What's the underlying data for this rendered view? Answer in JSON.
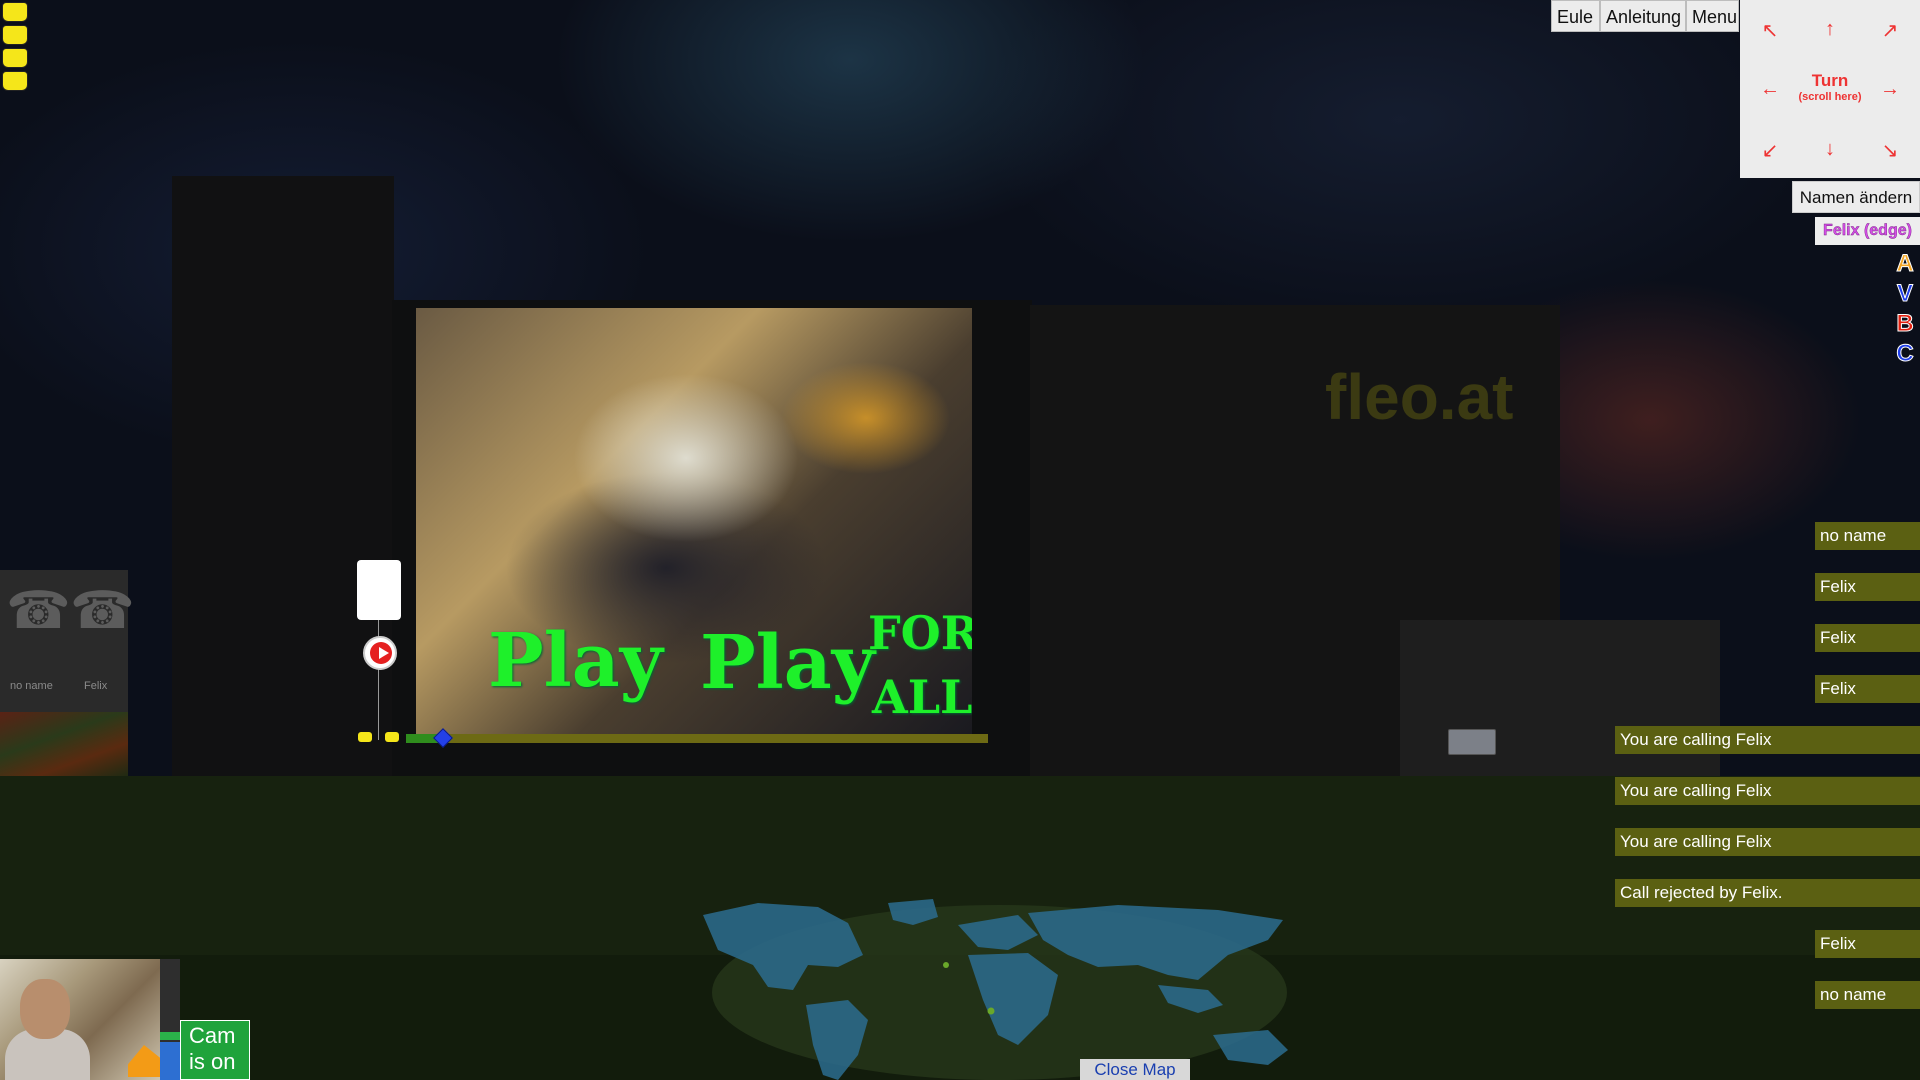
{
  "top_menu": {
    "eule": "Eule",
    "anleitung": "Anleitung",
    "menu": "Menu"
  },
  "dpad": {
    "up_left": "↖",
    "up": "↑",
    "up_right": "↗",
    "left": "←",
    "right": "→",
    "down_left": "↙",
    "down": "↓",
    "down_right": "↘",
    "turn_label": "Turn",
    "turn_hint": "(scroll here)"
  },
  "rename_button": "Namen ändern",
  "current_user": "Felix (edge)",
  "circle_buttons": [
    {
      "letter": "A",
      "color": "#f5a623"
    },
    {
      "letter": "V",
      "color": "#1f3ee8"
    },
    {
      "letter": "B",
      "color": "#e3200f"
    },
    {
      "letter": "C",
      "color": "#1f3ee8"
    }
  ],
  "site_brand": "fleo.at",
  "video": {
    "overlay_play_1": "Play",
    "overlay_play_2": "Play",
    "overlay_for": "FOR",
    "overlay_all": "ALL",
    "progress": 0.05
  },
  "phone_panel": {
    "labels": [
      "no name",
      "Felix"
    ]
  },
  "user_list": [
    "no name",
    "Felix",
    "Felix",
    "Felix"
  ],
  "call_messages": [
    "You are calling Felix",
    "You are calling Felix",
    "You are calling Felix",
    "Call rejected by Felix."
  ],
  "user_list_bottom": [
    "Felix",
    "no name"
  ],
  "close_map": "Close Map",
  "cam_status": {
    "line1": "Cam",
    "line2": "is on"
  }
}
